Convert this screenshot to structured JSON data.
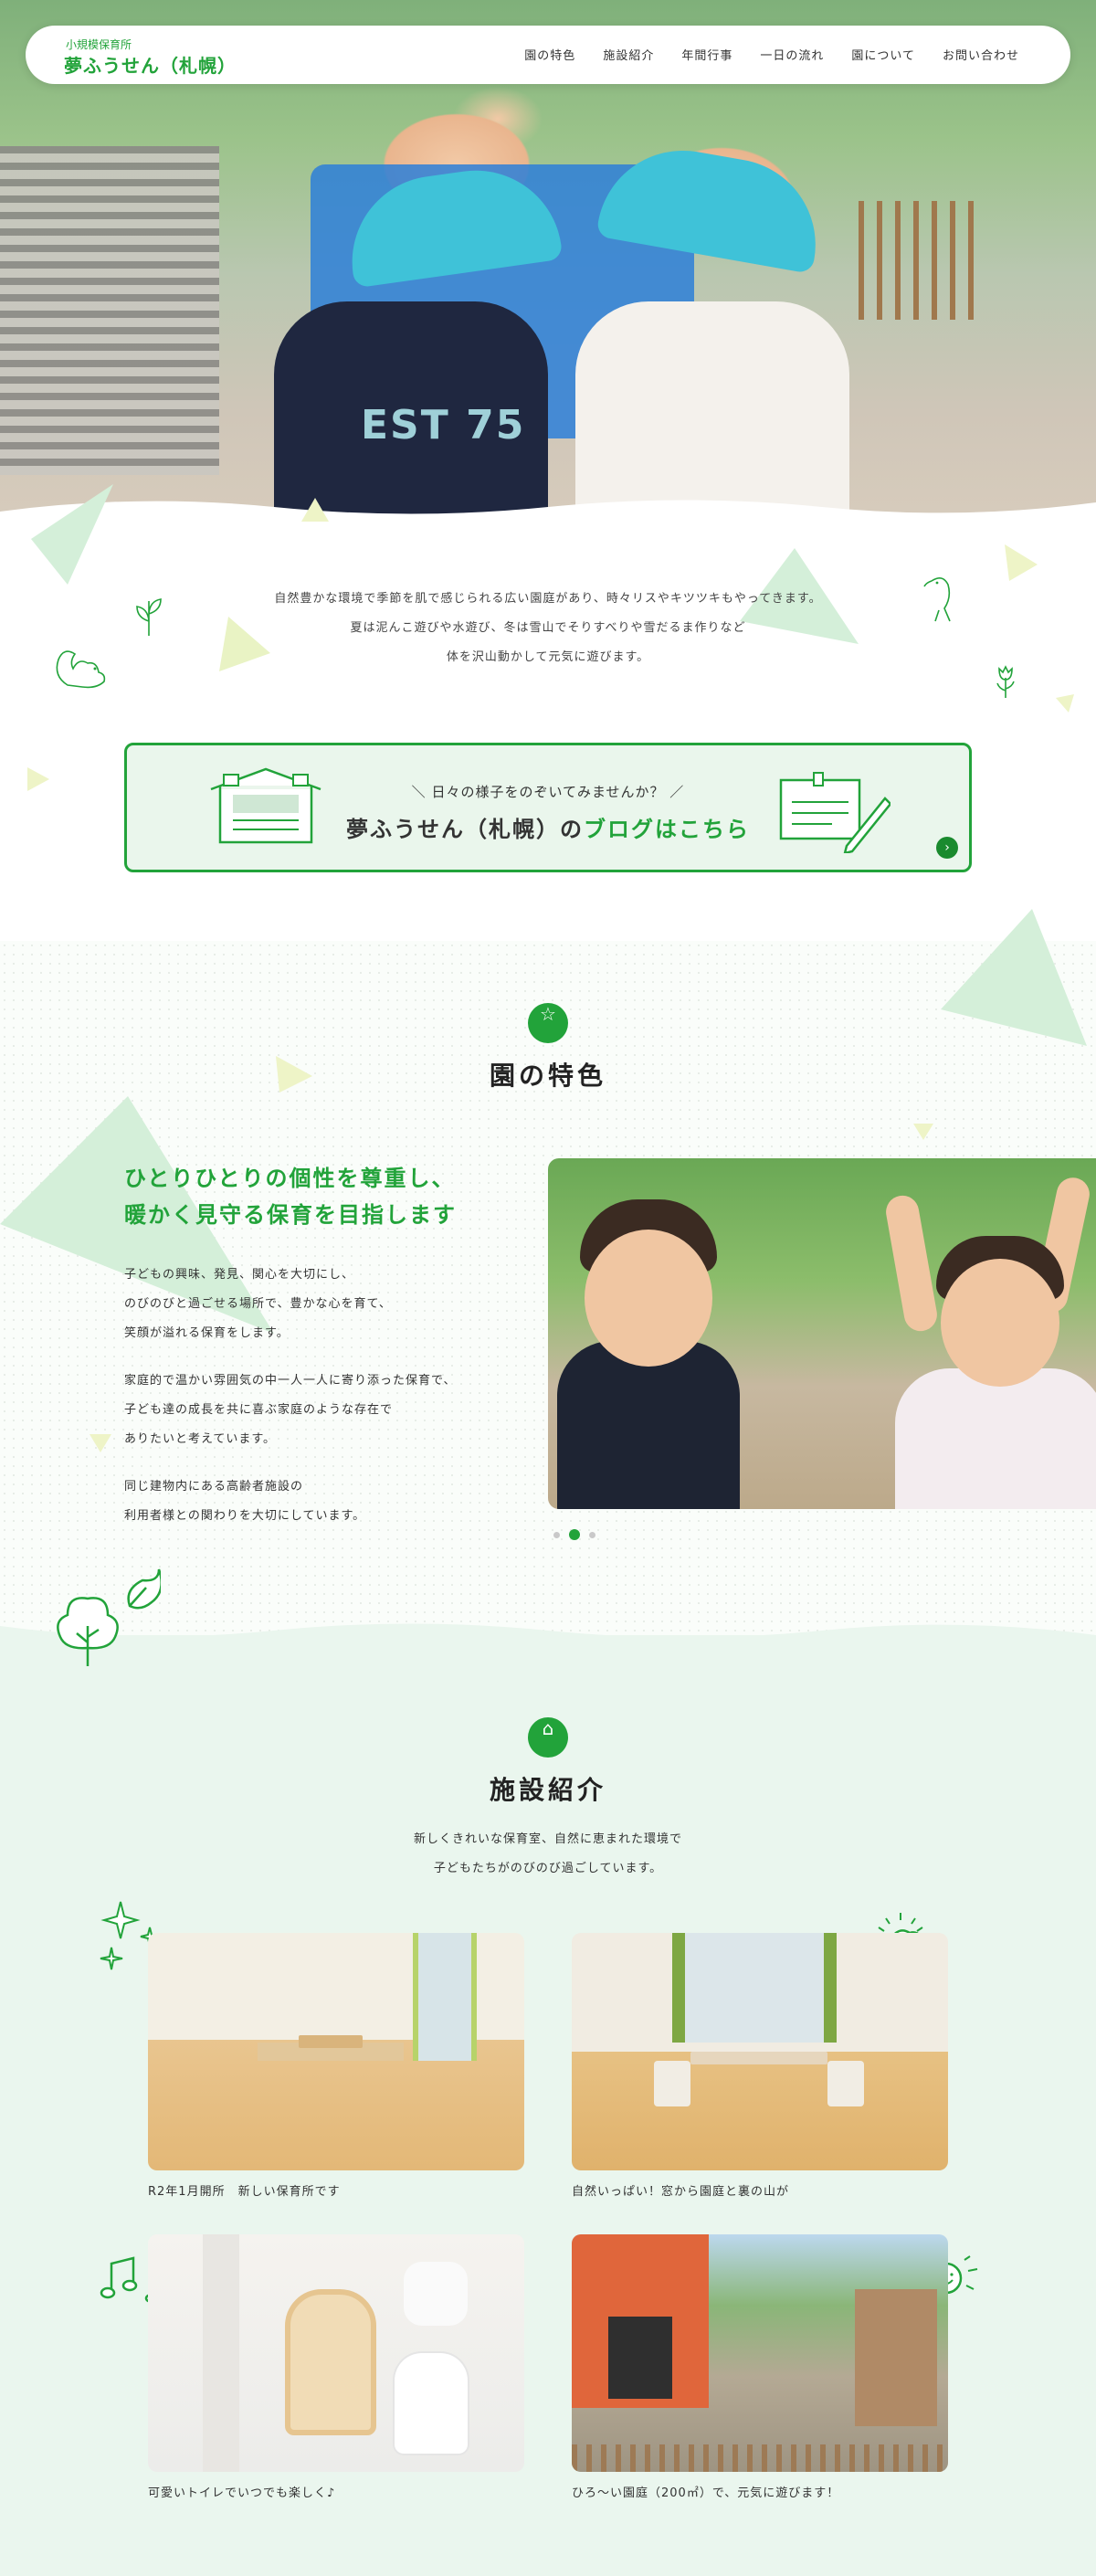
{
  "header": {
    "logo_sub": "小規模保育所",
    "logo_main": "夢ふうせん（札幌）",
    "nav": [
      "園の特色",
      "施設紹介",
      "年間行事",
      "一日の流れ",
      "園について",
      "お問い合わせ"
    ]
  },
  "hero": {
    "shirt_text": "EST 75"
  },
  "intro": {
    "lines": [
      "自然豊かな環境で季節を肌で感じられる広い園庭があり、時々リスやキツツキもやってきます。",
      "夏は泥んこ遊びや水遊び、冬は雪山でそりすべりや雪だるま作りなど",
      "体を沢山動かして元気に遊びます。"
    ]
  },
  "blog": {
    "lead": "＼ 日々の様子をのぞいてみませんか？ ／",
    "title_prefix": "夢ふうせん（札幌）の",
    "title_highlight": "ブログはこちら",
    "arrow": "›"
  },
  "features": {
    "icon": "☆",
    "title": "園の特色",
    "heading": [
      "ひとりひとりの個性を尊重し、",
      "暖かく見守る保育を目指します"
    ],
    "paragraphs": [
      [
        "子どもの興味、発見、関心を大切にし、",
        "のびのびと過ごせる場所で、豊かな心を育て、",
        "笑顔が溢れる保育をします。"
      ],
      [
        "家庭的で温かい雰囲気の中一人一人に寄り添った保育で、",
        "子ども達の成長を共に喜ぶ家庭のような存在で",
        "ありたいと考えています。"
      ],
      [
        "同じ建物内にある高齢者施設の",
        "利用者様との関わりを大切にしています。"
      ]
    ],
    "slider_pages": 3,
    "slider_active": 2
  },
  "facilities": {
    "icon": "⌂",
    "title": "施設紹介",
    "desc": [
      "新しくきれいな保育室、自然に恵まれた環境で",
      "子どもたちがのびのび過ごしています。"
    ],
    "cards": [
      {
        "caption": "R2年1月開所　新しい保育所です"
      },
      {
        "caption": "自然いっぱい！窓から園庭と裏の山が"
      },
      {
        "caption": "可愛いトイレでいつでも楽しく♪"
      },
      {
        "caption": "ひろ～い園庭（200㎡）で、元気に遊びます！"
      }
    ]
  },
  "colors": {
    "brand_green": "#22a33a",
    "light_green_bg": "#eaf6ee"
  }
}
